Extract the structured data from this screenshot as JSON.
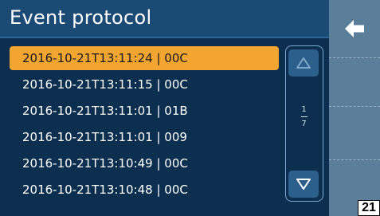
{
  "header": {
    "title": "Event protocol"
  },
  "nav": {
    "back_icon": "arrow-left-icon"
  },
  "events": [
    {
      "text": "2016-10-21T13:11:24 | 00C",
      "selected": true
    },
    {
      "text": "2016-10-21T13:11:15 | 00C",
      "selected": false
    },
    {
      "text": "2016-10-21T13:11:01 | 01B",
      "selected": false
    },
    {
      "text": "2016-10-21T13:11:01 | 009",
      "selected": false
    },
    {
      "text": "2016-10-21T13:10:49 | 00C",
      "selected": false
    },
    {
      "text": "2016-10-21T13:10:48 | 00C",
      "selected": false
    }
  ],
  "pagination": {
    "current": "1",
    "total": "7"
  },
  "scroll": {
    "up_icon": "triangle-up-icon",
    "down_icon": "triangle-down-icon"
  },
  "corner_label": "21",
  "colors": {
    "background": "#0d2f4f",
    "header": "#1b4a74",
    "selected": "#f2a531",
    "side_panel": "#5b7f99",
    "scroll_button": "#2c5f8c"
  }
}
